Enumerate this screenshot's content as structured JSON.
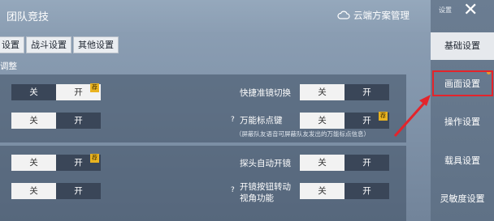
{
  "header": {
    "title": "团队竞技",
    "cloud_label": "云端方案管理"
  },
  "tabs": [
    "设置",
    "战斗设置",
    "其他设置"
  ],
  "section_label": "调整",
  "rows": {
    "r1_left": {
      "off": "关",
      "on": "开",
      "badge": "荐"
    },
    "r1_right": {
      "label": "快捷准镜切换",
      "off": "关",
      "on": "开"
    },
    "r2_left": {
      "off": "关",
      "on": "开"
    },
    "r2_right": {
      "label": "万能标点键",
      "off": "关",
      "on": "开",
      "badge": "荐",
      "hint": "（屏蔽队友语音可屏蔽队友发出的万能标点信息）"
    },
    "r3_left": {
      "off": "关",
      "on": "开",
      "badge": "荐"
    },
    "r3_right": {
      "label": "探头自动开镜",
      "off": "关",
      "on": "开"
    },
    "r4_left": {
      "off": "关",
      "on": "开"
    },
    "r4_right": {
      "label_line1": "开镜按钮转动",
      "label_line2": "视角功能",
      "off": "关",
      "on": "开"
    }
  },
  "qmark": "?",
  "right_panel": {
    "top_label": "设置",
    "close": "✕",
    "items": [
      "基础设置",
      "画面设置",
      "操作设置",
      "载具设置",
      "灵敏度设置"
    ]
  },
  "colors": {
    "highlight_box": "#e4242b",
    "badge": "#e9b320"
  }
}
